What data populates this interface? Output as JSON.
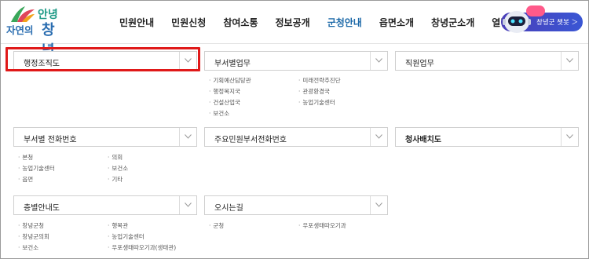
{
  "logo": {
    "top": "안녕",
    "left": "자연의",
    "big": "창녕"
  },
  "nav": {
    "items": [
      "민원안내",
      "민원신청",
      "참여소통",
      "정보공개",
      "군청안내",
      "읍면소개",
      "창녕군소개",
      "열린군수실"
    ],
    "active_index": 4
  },
  "chatbot": {
    "label": "창녕군 챗봇 ＞"
  },
  "sections": {
    "org": {
      "title": "행정조직도"
    },
    "dept": {
      "title": "부서별업무",
      "links": [
        "기획예산담당관",
        "미래전략추진단",
        "행정복지국",
        "관광환경국",
        "건설산업국",
        "농업기술센터",
        "보건소"
      ]
    },
    "staff": {
      "title": "직원업무"
    },
    "phone": {
      "title": "부서별 전화번호",
      "links": [
        "본청",
        "의회",
        "농업기술센터",
        "보건소",
        "읍면",
        "기타"
      ]
    },
    "main_phone": {
      "title": "주요민원부서전화번호"
    },
    "office": {
      "title": "청사배치도"
    },
    "floor": {
      "title": "층별안내도",
      "links": [
        "창녕군청",
        "행복관",
        "창녕군의회",
        "농업기술센터",
        "보건소",
        "우포생태따오기과(생태관)"
      ]
    },
    "directions": {
      "title": "오시는길",
      "links": [
        "군청",
        "우포생태따오기과"
      ]
    }
  },
  "colors": {
    "active_nav": "#1c69a8",
    "highlight": "#e01919",
    "chatbot": "#3a56d4"
  }
}
